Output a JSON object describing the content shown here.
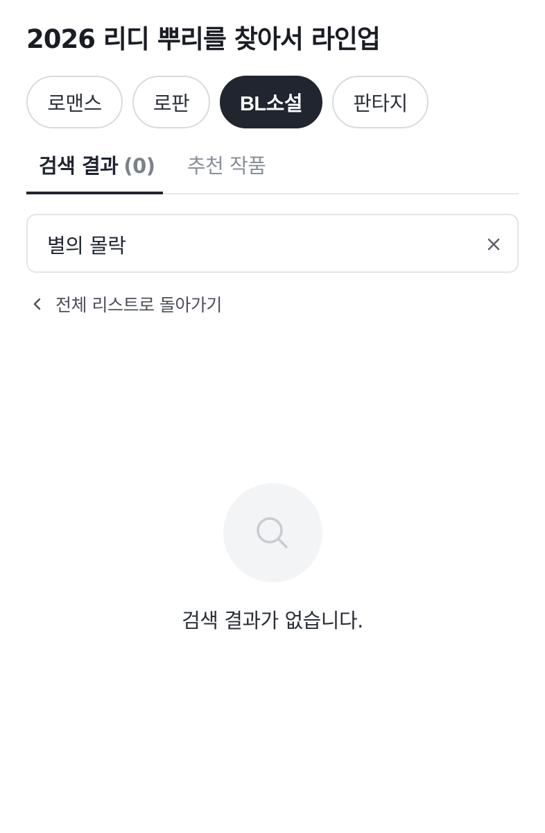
{
  "header": {
    "title": "2026 리디 뿌리를 찾아서 라인업"
  },
  "genre_tabs": [
    {
      "label": "로맨스",
      "active": false
    },
    {
      "label": "로판",
      "active": false
    },
    {
      "label": "BL소설",
      "active": true
    },
    {
      "label": "판타지",
      "active": false
    }
  ],
  "result_tabs": {
    "search_results_label": "검색 결과",
    "search_results_count": "(0)",
    "recommended_label": "추천 작품"
  },
  "search": {
    "value": "별의 몰락",
    "clear_icon": "close-icon"
  },
  "back_link": {
    "label": "전체 리스트로 돌아가기",
    "icon": "chevron-left-icon"
  },
  "empty_state": {
    "icon": "search-icon",
    "message": "검색 결과가 없습니다."
  },
  "colors": {
    "active_chip_bg": "#20252f",
    "chip_border": "#d8dade",
    "muted_text": "#8a8f98",
    "empty_circle_bg": "#f3f4f6"
  }
}
